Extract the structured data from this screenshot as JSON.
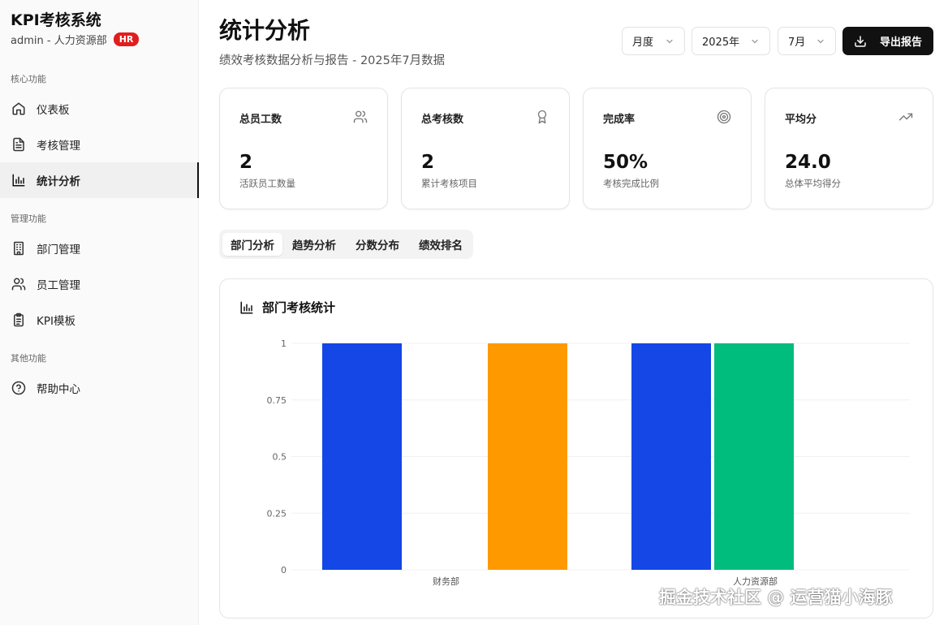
{
  "sidebar": {
    "brand": "KPI考核系统",
    "user": "admin - 人力资源部",
    "role_badge": "HR",
    "groups": [
      {
        "title": "核心功能"
      },
      {
        "title": "管理功能"
      },
      {
        "title": "其他功能"
      }
    ],
    "items": [
      {
        "label": "仪表板",
        "icon": "home-icon"
      },
      {
        "label": "考核管理",
        "icon": "document-icon"
      },
      {
        "label": "统计分析",
        "icon": "bar-chart-icon",
        "active": true
      },
      {
        "label": "部门管理",
        "icon": "building-icon"
      },
      {
        "label": "员工管理",
        "icon": "users-icon"
      },
      {
        "label": "KPI模板",
        "icon": "clipboard-icon"
      },
      {
        "label": "帮助中心",
        "icon": "help-icon"
      }
    ]
  },
  "header": {
    "title": "统计分析",
    "subtitle": "绩效考核数据分析与报告 - 2025年7月数据",
    "period_select": "月度",
    "year_select": "2025年",
    "month_select": "7月",
    "export_label": "导出报告"
  },
  "stats": [
    {
      "label": "总员工数",
      "value": "2",
      "desc": "活跃员工数量",
      "icon": "users-icon"
    },
    {
      "label": "总考核数",
      "value": "2",
      "desc": "累计考核项目",
      "icon": "award-icon"
    },
    {
      "label": "完成率",
      "value": "50%",
      "desc": "考核完成比例",
      "icon": "target-icon"
    },
    {
      "label": "平均分",
      "value": "24.0",
      "desc": "总体平均得分",
      "icon": "trending-up-icon"
    }
  ],
  "tabs": [
    {
      "label": "部门分析",
      "active": true
    },
    {
      "label": "趋势分析"
    },
    {
      "label": "分数分布"
    },
    {
      "label": "绩效排名"
    }
  ],
  "chart_title": "部门考核统计",
  "chart_data": {
    "type": "bar",
    "categories": [
      "财务部",
      "人力资源部"
    ],
    "series": [
      {
        "color": "#1447e6",
        "values": [
          1,
          1
        ]
      },
      {
        "color": "#fe9a00",
        "values": [
          1,
          0
        ]
      },
      {
        "color": "#00bc7d",
        "values": [
          0,
          1
        ]
      }
    ],
    "yticks": [
      "1",
      "0.75",
      "0.5",
      "0.25",
      "0"
    ],
    "ylim": [
      0,
      1
    ],
    "grid": true
  },
  "watermark": "掘金技术社区 @ 运营猫小海豚"
}
